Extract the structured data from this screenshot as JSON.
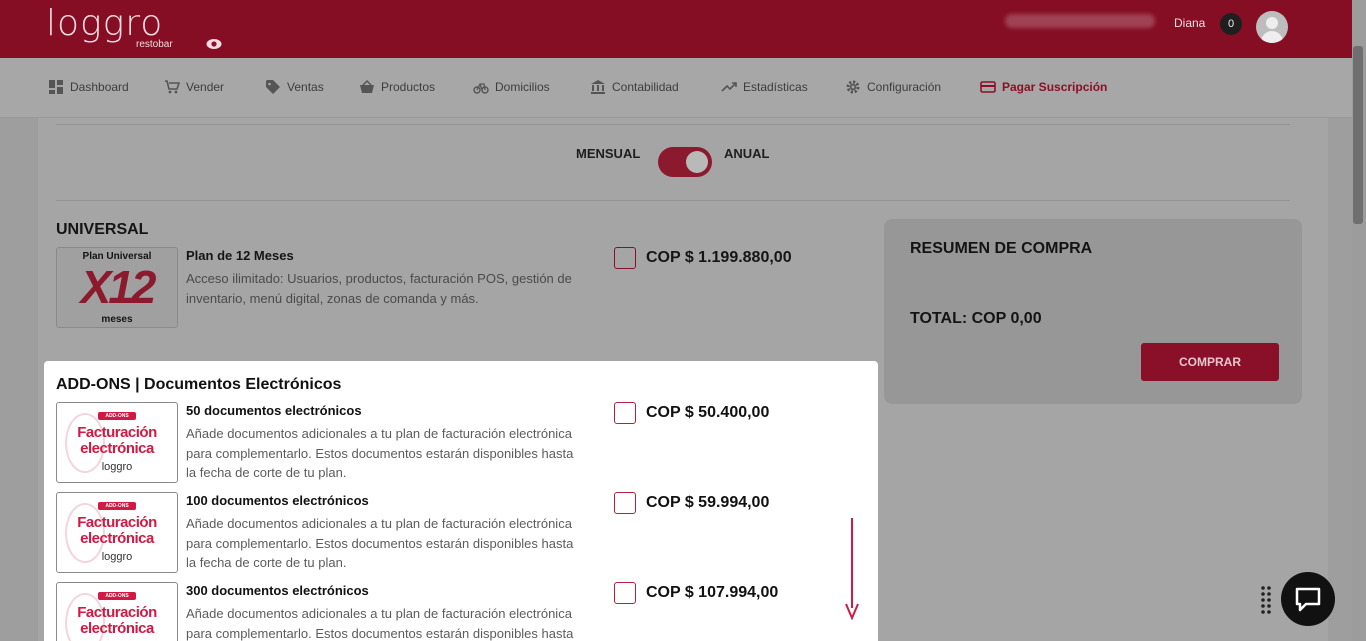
{
  "brand": {
    "logo_text": "loggro",
    "logo_sub": "restobar",
    "accent": "#a4122d"
  },
  "header": {
    "user_name": "Diana",
    "notification_count": "0"
  },
  "nav": {
    "items": [
      {
        "label": "Dashboard",
        "icon": "dashboard-icon"
      },
      {
        "label": "Vender",
        "icon": "cart-icon"
      },
      {
        "label": "Ventas",
        "icon": "tag-icon"
      },
      {
        "label": "Productos",
        "icon": "basket-icon"
      },
      {
        "label": "Domicilios",
        "icon": "bike-icon"
      },
      {
        "label": "Contabilidad",
        "icon": "bank-icon"
      },
      {
        "label": "Estadísticas",
        "icon": "trend-icon"
      },
      {
        "label": "Configuración",
        "icon": "gear-icon"
      },
      {
        "label": "Pagar Suscripción",
        "icon": "card-icon",
        "active": true
      }
    ]
  },
  "billing_toggle": {
    "left": "MENSUAL",
    "right": "ANUAL",
    "selected": "ANUAL"
  },
  "universal": {
    "title": "UNIVERSAL",
    "thumb": {
      "top": "Plan Universal",
      "big": "X12",
      "bottom": "meses"
    },
    "plan_title": "Plan de 12 Meses",
    "plan_desc": "Acceso ilimitado: Usuarios, productos, facturación POS, gestión de inventario, menú digital, zonas de comanda y más.",
    "price": "COP $ 1.199.880,00"
  },
  "summary": {
    "title": "RESUMEN DE COMPRA",
    "total": "TOTAL: COP 0,00",
    "buy_label": "COMPRAR"
  },
  "addons": {
    "title": "ADD-ONS | Documentos Electrónicos",
    "thumb": {
      "tag": "ADD-ONS",
      "line1": "Facturación",
      "line2": "electrónica",
      "brand": "loggro"
    },
    "items": [
      {
        "title": "50 documentos electrónicos",
        "desc": "Añade documentos adicionales a tu plan de facturación electrónica para complementarlo. Estos documentos estarán disponibles hasta la fecha de corte de tu plan.",
        "price": "COP $ 50.400,00"
      },
      {
        "title": "100 documentos electrónicos",
        "desc": "Añade documentos adicionales a tu plan de facturación electrónica para complementarlo. Estos documentos estarán disponibles hasta la fecha de corte de tu plan.",
        "price": "COP $ 59.994,00"
      },
      {
        "title": "300 documentos electrónicos",
        "desc": "Añade documentos adicionales a tu plan de facturación electrónica para complementarlo. Estos documentos estarán disponibles hasta la fecha de corte de tu plan.",
        "price": "COP $ 107.994,00"
      }
    ]
  }
}
